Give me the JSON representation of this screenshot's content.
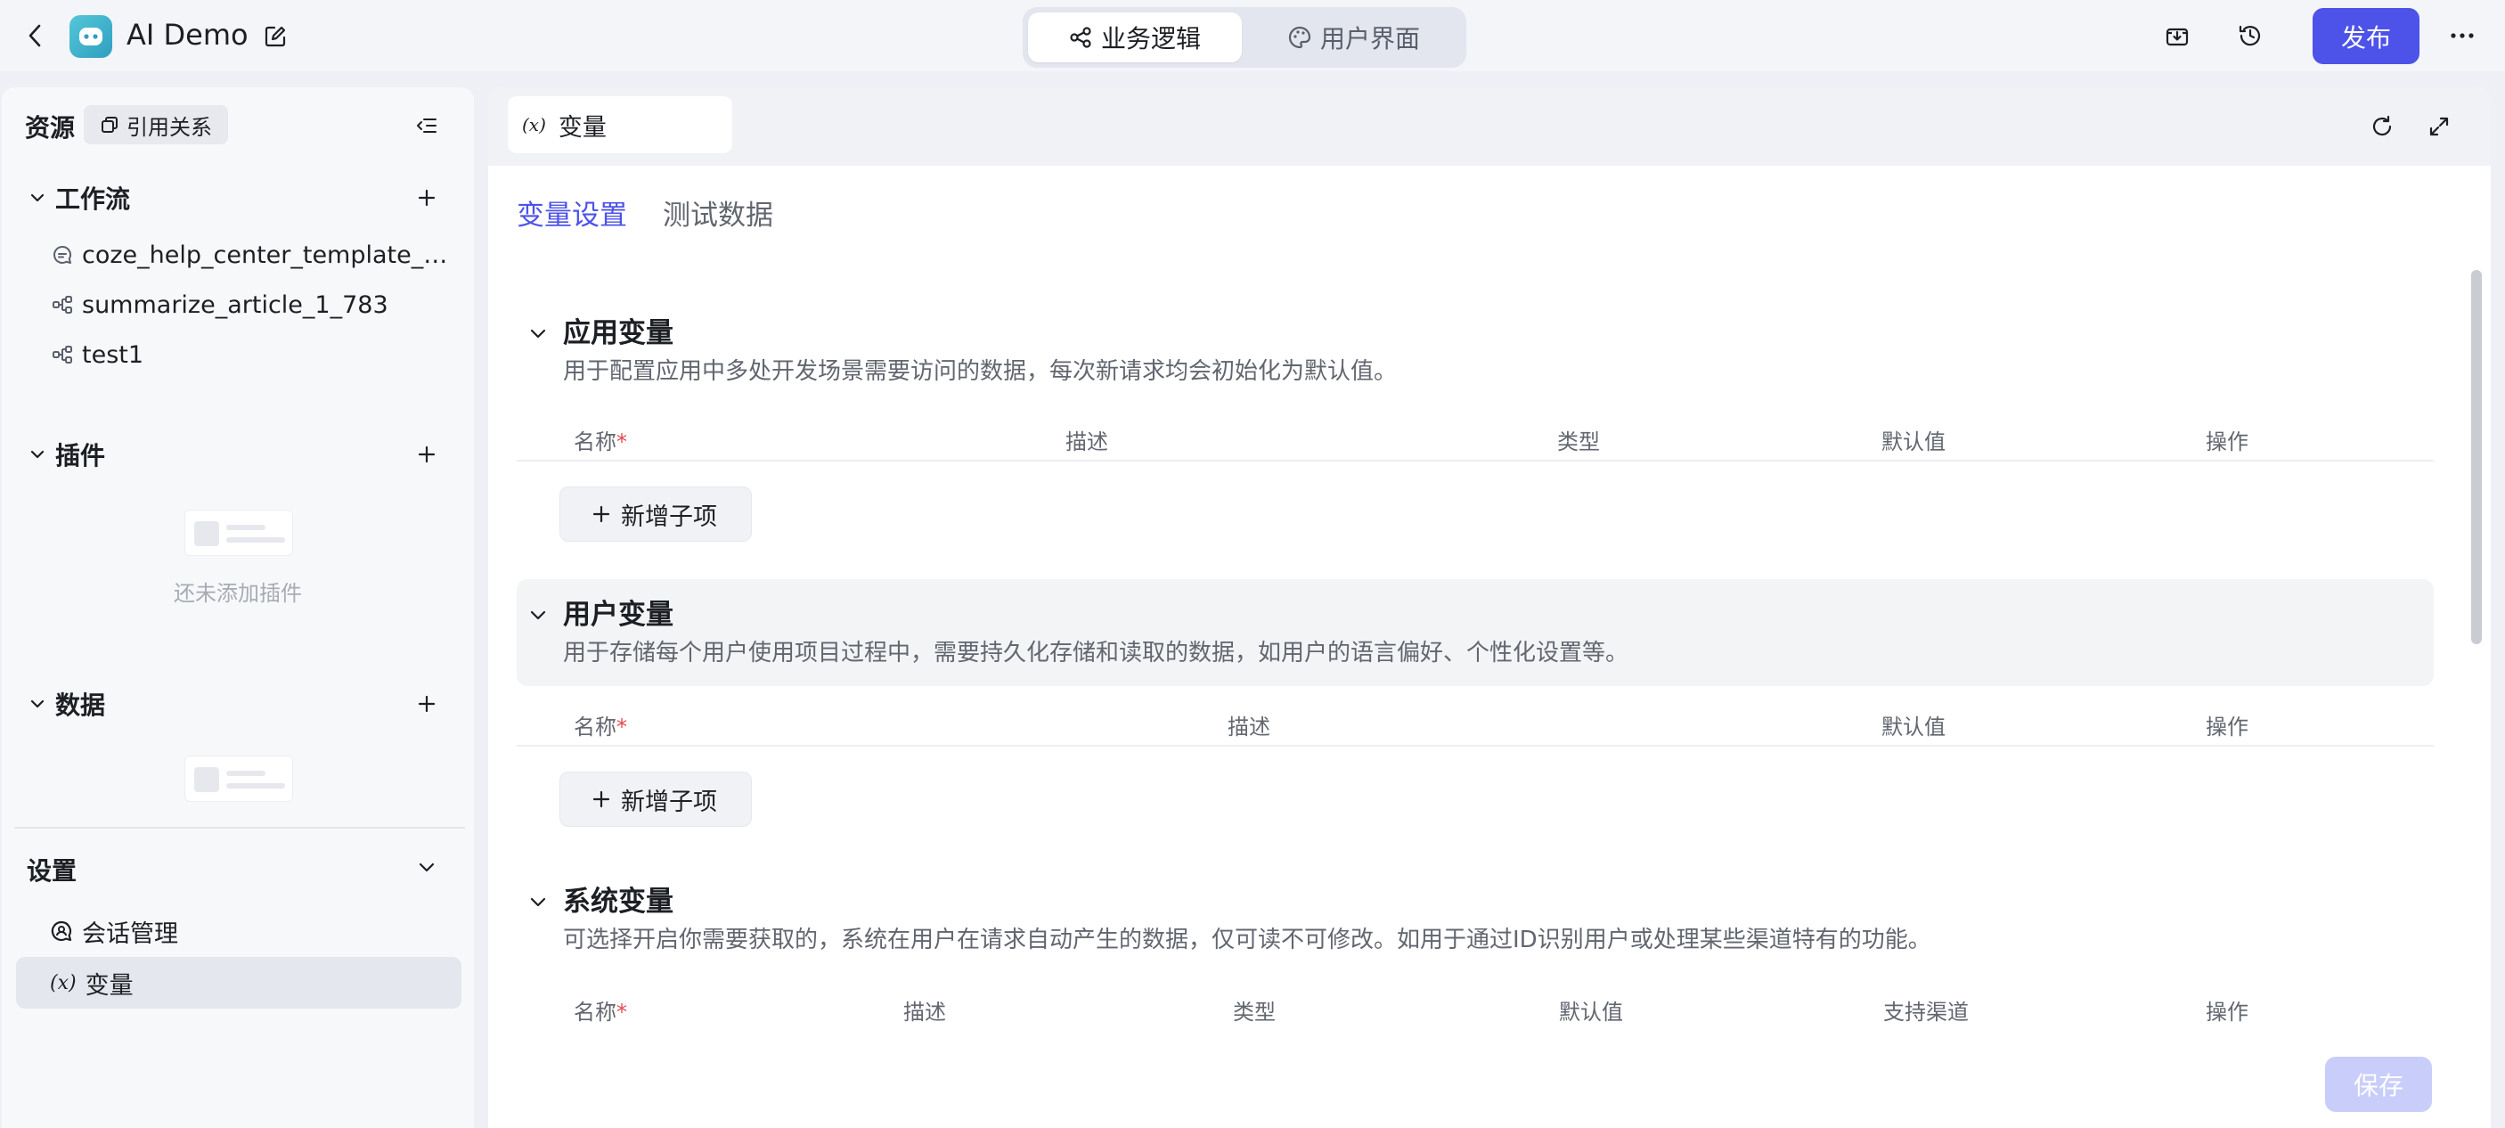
{
  "app": {
    "title": "AI Demo"
  },
  "mode_switch": {
    "tabs": [
      {
        "label": "业务逻辑",
        "active": true
      },
      {
        "label": "用户界面",
        "active": false
      }
    ]
  },
  "toolbar": {
    "publish_label": "发布"
  },
  "sidebar": {
    "header": "资源",
    "references_label": "引用关系",
    "workflow": {
      "title": "工作流",
      "items": [
        {
          "label": "coze_help_center_template_1...",
          "icon": "chat-icon"
        },
        {
          "label": "summarize_article_1_783",
          "icon": "workflow-icon"
        },
        {
          "label": "test1",
          "icon": "workflow-icon"
        }
      ]
    },
    "plugins": {
      "title": "插件",
      "empty_text": "还未添加插件"
    },
    "data": {
      "title": "数据"
    },
    "settings": {
      "title": "设置",
      "items": [
        {
          "label": "会话管理",
          "icon": "conversation-icon",
          "active": false
        },
        {
          "label": "变量",
          "icon": "variable-icon",
          "active": true
        }
      ]
    }
  },
  "main": {
    "tab_label": "变量",
    "sub_tabs": [
      {
        "label": "变量设置",
        "active": true
      },
      {
        "label": "测试数据",
        "active": false
      }
    ],
    "sections": [
      {
        "title": "应用变量",
        "description": "用于配置应用中多处开发场景需要访问的数据，每次新请求均会初始化为默认值。",
        "columns": [
          "名称",
          "描述",
          "类型",
          "默认值",
          "操作"
        ],
        "add_label": "新增子项"
      },
      {
        "title": "用户变量",
        "description": "用于存储每个用户使用项目过程中，需要持久化存储和读取的数据，如用户的语言偏好、个性化设置等。",
        "columns": [
          "名称",
          "描述",
          "默认值",
          "操作"
        ],
        "add_label": "新增子项"
      },
      {
        "title": "系统变量",
        "description": "可选择开启你需要获取的，系统在用户在请求自动产生的数据，仅可读不可修改。如用于通过ID识别用户或处理某些渠道特有的功能。",
        "columns": [
          "名称",
          "描述",
          "类型",
          "默认值",
          "支持渠道",
          "操作"
        ]
      }
    ],
    "required_mark": "*",
    "save_label": "保存"
  },
  "colors": {
    "accent": "#4d53e8",
    "required": "#e5484d",
    "save_disabled": "#c9cdfa"
  }
}
